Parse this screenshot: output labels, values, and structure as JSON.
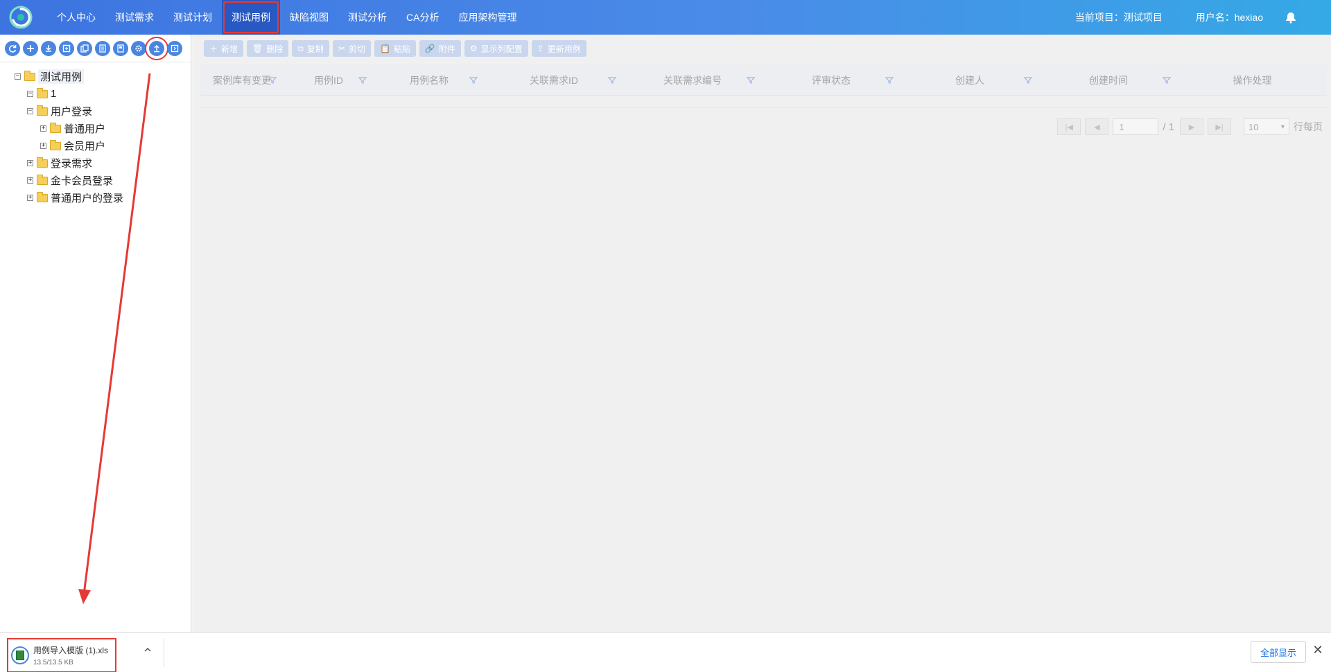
{
  "nav": {
    "items": [
      {
        "label": "个人中心"
      },
      {
        "label": "测试需求"
      },
      {
        "label": "测试计划"
      },
      {
        "label": "测试用例"
      },
      {
        "label": "缺陷视图"
      },
      {
        "label": "测试分析"
      },
      {
        "label": "CA分析"
      },
      {
        "label": "应用架构管理"
      }
    ],
    "active": "测试用例",
    "project": "当前项目：测试项目",
    "user": "用户名：hexiao",
    "bell_icon": "bell-icon"
  },
  "left_toolbar": {
    "icons": [
      "refresh-icon",
      "add-icon",
      "download-icon",
      "export-icon",
      "copy-icon",
      "list-icon",
      "document-icon",
      "settings-icon",
      "upload-icon",
      "collapse-icon"
    ],
    "highlighted": "upload-icon"
  },
  "tree": {
    "root": "测试用例",
    "nodes": [
      {
        "label": "1",
        "toggle": "⊟"
      },
      {
        "label": "用户登录",
        "toggle": "⊟"
      },
      {
        "label": "普通用户",
        "toggle": "⊞"
      },
      {
        "label": "会员用户",
        "toggle": "⊞"
      },
      {
        "label": "登录需求",
        "toggle": "⊞"
      },
      {
        "label": "金卡会员登录",
        "toggle": "⊞"
      },
      {
        "label": "普通用户的登录",
        "toggle": "⊞"
      }
    ],
    "root_toggle": "⊟"
  },
  "actions": {
    "new": "新增",
    "delete": "删除",
    "copy": "复制",
    "cut": "剪切",
    "paste": "粘贴",
    "attach": "附件",
    "columns": "显示列配置",
    "update": "更新用例"
  },
  "grid": {
    "columns": [
      "案例库有变更",
      "用例ID",
      "用例名称",
      "关联需求ID",
      "关联需求编号",
      "评审状态",
      "创建人",
      "创建时间",
      "操作处理"
    ]
  },
  "pager": {
    "page": "1",
    "total": "/ 1",
    "page_size": "10",
    "suffix": "行每页"
  },
  "download": {
    "filename": "用例导入模版 (1).xls",
    "size": "13.5/13.5 KB",
    "show_all": "全部显示",
    "close": "✕"
  },
  "colors": {
    "nav_start": "#3d74e0",
    "nav_end": "#35a9e6",
    "highlight": "#e53935",
    "toolbar_icon": "#4a86e0"
  }
}
